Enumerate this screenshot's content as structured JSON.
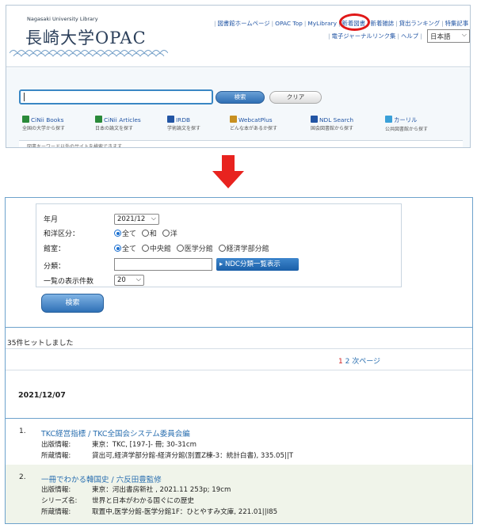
{
  "top": {
    "logo_small": "Nagasaki University Library",
    "logo_main": "長崎大学OPAC",
    "nav_row1": [
      "図書館ホームページ",
      "OPAC Top",
      "MyLibrary",
      "新着図書",
      "新着雑誌",
      "貸出ランキング",
      "特集記事"
    ],
    "nav_row2": [
      "電子ジャーナルリンク集",
      "ヘルプ"
    ],
    "language": "日本語",
    "search_button": "検索",
    "clear_button": "クリア",
    "db_links": [
      {
        "title": "CiNii Books",
        "desc": "全国の大学から探す",
        "color": "#2a8a3a"
      },
      {
        "title": "CiNii Articles",
        "desc": "日本の論文を探す",
        "color": "#2a8a3a"
      },
      {
        "title": "IRDB",
        "desc": "学術論文を探す",
        "color": "#2255a4"
      },
      {
        "title": "WebcatPlus",
        "desc": "どんな本があるか探す",
        "color": "#c89020"
      },
      {
        "title": "NDL Search",
        "desc": "国会図書館から探す",
        "color": "#2255a4"
      },
      {
        "title": "カーリル",
        "desc": "公共図書館から探す",
        "color": "#3aa0d8"
      }
    ],
    "notice": "図書キーワード以外のサイトを検索できます"
  },
  "form": {
    "year_month_label": "年月",
    "year_month_value": "2021/12",
    "lang_label": "和洋区分：",
    "lang_options": [
      "全て",
      "和",
      "洋"
    ],
    "lang_selected": 0,
    "branch_label": "館室：",
    "branch_options": [
      "全て",
      "中央館",
      "医学分館",
      "経済学部分館"
    ],
    "branch_selected": 0,
    "class_label": "分類：",
    "ndc_button": "NDC分類一覧表示",
    "per_page_label": "一覧の表示件数",
    "per_page_value": "20",
    "search_button": "検索"
  },
  "results_summary": {
    "hits_text": "35件ヒットしました",
    "pages": [
      "1",
      "2"
    ],
    "current_page": "1",
    "next_label": "次ページ"
  },
  "date_heading": "2021/12/07",
  "results": [
    {
      "num": "1.",
      "title": "TKC経営指標 / TKC全国会システム委員会編",
      "fields": [
        {
          "k": "出版情報:",
          "v": "東京：TKC, [197-]- 冊; 30-31cm"
        },
        {
          "k": "所蔵情報:",
          "v": "貸出可,経済学部分館-経済分館(別置Z棟-3：統計白書), 335.05||T"
        }
      ]
    },
    {
      "num": "2.",
      "title": "一冊でわかる韓国史 / 六反田豊監修",
      "fields": [
        {
          "k": "出版情報:",
          "v": "東京：河出書房新社 , 2021.11 253p; 19cm"
        },
        {
          "k": "シリーズ名:",
          "v": "世界と日本がわかる国ぐにの歴史"
        },
        {
          "k": "所蔵情報:",
          "v": "取置中,医学分館-医学分館1F：ひとやすみ文庫, 221.01||I85"
        }
      ]
    }
  ]
}
